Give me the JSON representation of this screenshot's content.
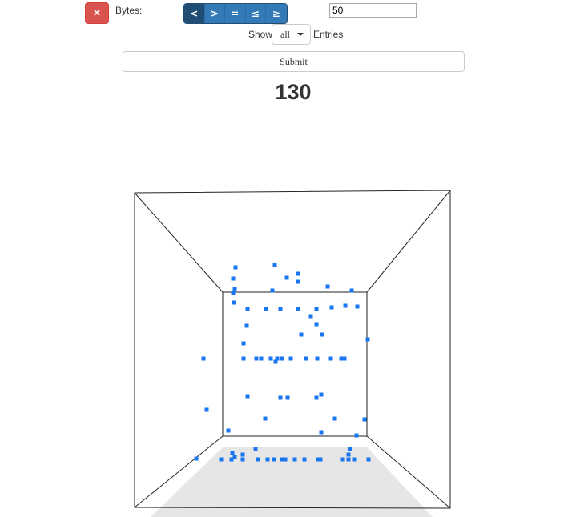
{
  "toolbar": {
    "close_icon": "×",
    "bytes_label": "Bytes:",
    "operators": [
      {
        "label": "<",
        "active": true
      },
      {
        "label": ">",
        "active": false
      },
      {
        "label": "=",
        "active": false
      },
      {
        "label": "≤",
        "active": false
      },
      {
        "label": "≥",
        "active": false
      }
    ],
    "value": "50"
  },
  "entries": {
    "show_label": "Show",
    "selected": "all",
    "entries_label": "Entries"
  },
  "submit_label": "Submit",
  "count": "130",
  "colors": {
    "danger": "#d9534f",
    "primary": "#337ab7",
    "primary_active": "#204d74",
    "point": "#1a75f0",
    "floor": "#e6e6e6"
  },
  "icons": {
    "close": "close-icon",
    "dropdown": "caret-down-icon"
  }
}
